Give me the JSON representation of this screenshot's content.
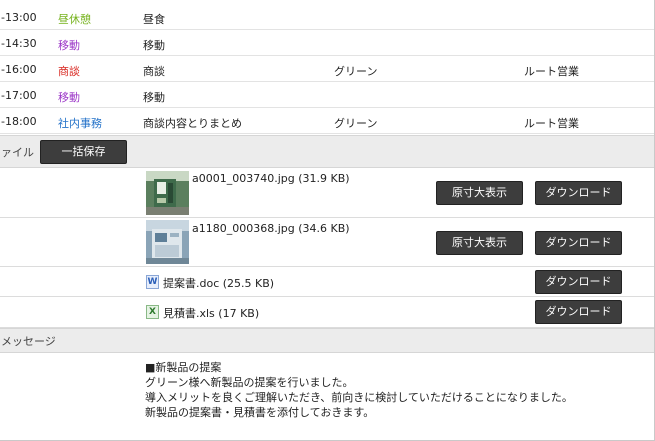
{
  "schedule": [
    {
      "time": "-13:00",
      "type": "昼休憩",
      "type_color": "#77b31f",
      "desc": "昼食",
      "customer": "",
      "route": ""
    },
    {
      "time": "-14:30",
      "type": "移動",
      "type_color": "#9b36c7",
      "desc": "移動",
      "customer": "",
      "route": ""
    },
    {
      "time": "-16:00",
      "type": "商談",
      "type_color": "#d8261f",
      "desc": "商談",
      "customer": "グリーン",
      "route": "ルート営業"
    },
    {
      "time": "-17:00",
      "type": "移動",
      "type_color": "#9b36c7",
      "desc": "移動",
      "customer": "",
      "route": ""
    },
    {
      "time": "-18:00",
      "type": "社内事務",
      "type_color": "#2573c9",
      "desc": "商談内容とりまとめ",
      "customer": "グリーン",
      "route": "ルート営業"
    }
  ],
  "files_section": {
    "label": "ァイル",
    "bulk_save_label": "一括保存"
  },
  "files": [
    {
      "name": "a0001_003740.jpg (31.9 KB)",
      "kind": "image",
      "view_label": "原寸大表示",
      "download_label": "ダウンロード"
    },
    {
      "name": "a1180_000368.jpg (34.6 KB)",
      "kind": "image",
      "view_label": "原寸大表示",
      "download_label": "ダウンロード"
    },
    {
      "name": "提案書.doc (25.5 KB)",
      "kind": "word-doc",
      "download_label": "ダウンロード"
    },
    {
      "name": "見積書.xls (17 KB)",
      "kind": "excel-sheet",
      "download_label": "ダウンロード"
    }
  ],
  "message_section": {
    "label": "メッセージ",
    "lines": [
      "■新製品の提案",
      "グリーン様へ新製品の提案を行いました。",
      "導入メリットを良くご理解いただき、前向きに検討していただけることになりました。",
      "新製品の提案書・見積書を添付しておきます。"
    ]
  },
  "colors": {
    "button_bg": "#3d3d3d",
    "section_bg": "#ececec"
  }
}
